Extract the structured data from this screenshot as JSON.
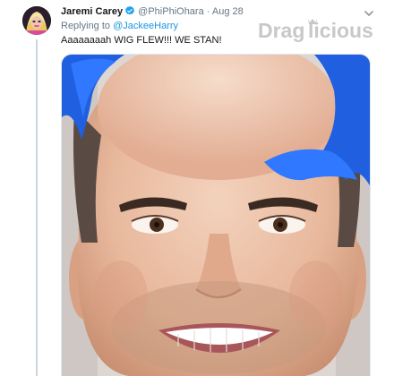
{
  "tweet": {
    "display_name": "Jaremi Carey",
    "handle": "@PhiPhiOhara",
    "separator": "·",
    "date": "Aug 28",
    "reply_prefix": "Replying to",
    "reply_to": "@JackeeHarry",
    "text": "Aaaaaaaah WIG FLEW!!! WE STAN!"
  },
  "watermark": {
    "part1": "Drag",
    "part2": "licious"
  },
  "icons": {
    "verified": "verified-badge-icon",
    "caret": "chevron-down-icon"
  },
  "colors": {
    "link": "#1b95e0",
    "secondary_text": "#657786",
    "watermark": "#c8c8c8",
    "hair": "#1f5fe0"
  }
}
